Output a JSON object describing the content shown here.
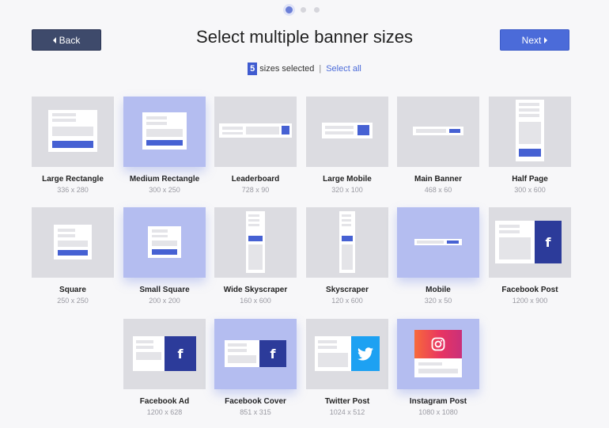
{
  "pagination": {
    "count": 3,
    "active": 0
  },
  "header": {
    "title": "Select multiple banner sizes",
    "back_label": "Back",
    "next_label": "Next"
  },
  "selection": {
    "count": "5",
    "text": "sizes selected",
    "separator": "|",
    "select_all": "Select all"
  },
  "colors": {
    "accent": "#4b6bd9",
    "back_button": "#3e4a6b",
    "selected_tile": "#b4bdf0",
    "tile": "#dcdce1",
    "facebook": "#2c3b9a",
    "twitter": "#1da1f2"
  },
  "banners": [
    {
      "name": "Large Rectangle",
      "size": "336 x 280",
      "selected": false
    },
    {
      "name": "Medium Rectangle",
      "size": "300 x 250",
      "selected": true
    },
    {
      "name": "Leaderboard",
      "size": "728 x 90",
      "selected": false
    },
    {
      "name": "Large Mobile",
      "size": "320 x 100",
      "selected": false
    },
    {
      "name": "Main Banner",
      "size": "468 x 60",
      "selected": false
    },
    {
      "name": "Half Page",
      "size": "300 x 600",
      "selected": false
    },
    {
      "name": "Square",
      "size": "250 x 250",
      "selected": false
    },
    {
      "name": "Small Square",
      "size": "200 x 200",
      "selected": true
    },
    {
      "name": "Wide Skyscraper",
      "size": "160 x 600",
      "selected": false
    },
    {
      "name": "Skyscraper",
      "size": "120 x 600",
      "selected": false
    },
    {
      "name": "Mobile",
      "size": "320 x 50",
      "selected": true
    },
    {
      "name": "Facebook Post",
      "size": "1200 x 900",
      "selected": false
    },
    {
      "name": "Facebook Ad",
      "size": "1200 x 628",
      "selected": false
    },
    {
      "name": "Facebook Cover",
      "size": "851 x 315",
      "selected": true
    },
    {
      "name": "Twitter Post",
      "size": "1024 x 512",
      "selected": false
    },
    {
      "name": "Instagram Post",
      "size": "1080 x 1080",
      "selected": true
    }
  ]
}
